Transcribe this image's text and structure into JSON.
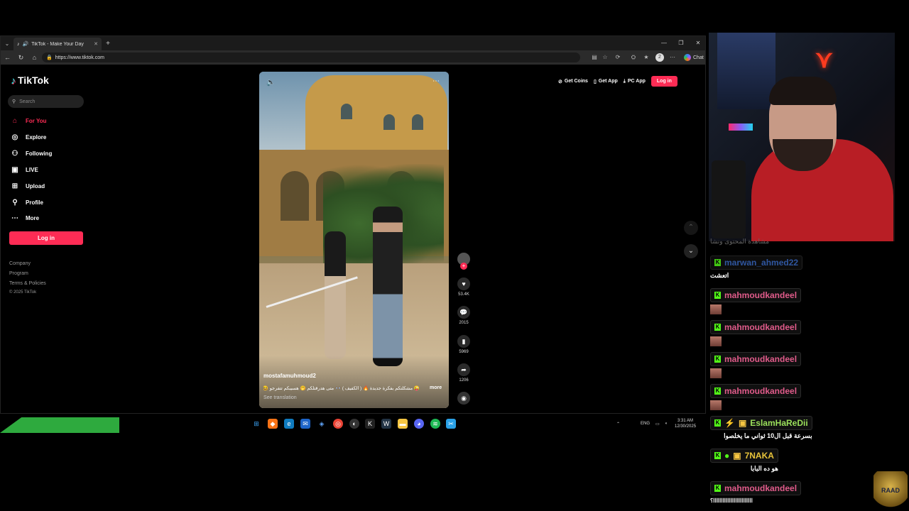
{
  "browser": {
    "tab_title": "TikTok - Make Your Day",
    "url": "https://www.tiktok.com",
    "chat_label": "Chat",
    "profile_initial": "2"
  },
  "tiktok": {
    "logo": "TikTok",
    "search_placeholder": "Search",
    "nav": [
      {
        "label": "For You",
        "icon": "home-icon"
      },
      {
        "label": "Explore",
        "icon": "compass-icon"
      },
      {
        "label": "Following",
        "icon": "user-icon"
      },
      {
        "label": "LIVE",
        "icon": "live-icon"
      },
      {
        "label": "Upload",
        "icon": "upload-icon"
      },
      {
        "label": "Profile",
        "icon": "profile-icon"
      },
      {
        "label": "More",
        "icon": "more-icon"
      }
    ],
    "login_side": "Log in",
    "footer": [
      "Company",
      "Program",
      "Terms & Policies",
      "© 2025 TikTok"
    ],
    "top": {
      "coins": "Get Coins",
      "app": "Get App",
      "pc": "PC App",
      "login": "Log in"
    },
    "video": {
      "author": "mostafamuhmoud2",
      "caption": "😜 مشكلتكم بفكرة جديدة 🔥 ( الكفيف ) 👓 متى هدرقتلكم 🤭 هسيبكم تتفرجو 😆",
      "more": "more",
      "translate": "See translation"
    },
    "actions": {
      "likes": "53.4K",
      "comments": "2015",
      "saves": "5969",
      "shares": "1206"
    }
  },
  "taskbar": {
    "lang": "ENG",
    "time": "3:31 AM",
    "date": "12/30/2025"
  },
  "chat": [
    {
      "user": "marwan_ahmed22",
      "color": "#3b6cc8",
      "text": "اتعشت",
      "partial_above": "مشاهدة المحتوى ونشا"
    },
    {
      "user": "mahmoudkandeel",
      "color": "#e05b8a",
      "emote": true
    },
    {
      "user": "mahmoudkandeel",
      "color": "#e05b8a",
      "emote": true
    },
    {
      "user": "mahmoudkandeel",
      "color": "#e05b8a",
      "emote": true
    },
    {
      "user": "mahmoudkandeel",
      "color": "#e05b8a",
      "emote": true
    },
    {
      "user": "EslamHaReDii",
      "color": "#9be05b",
      "text": "بسرعة قبل ال10 ثواني ما يخلصوا"
    },
    {
      "user": "7NAKA",
      "color": "#e8c43a",
      "text": "هو ده البابا"
    },
    {
      "user": "mahmoudkandeel",
      "color": "#e05b8a",
      "text": "ااااااااااااااااااااااااا؟"
    }
  ],
  "watermark": "RAAD"
}
